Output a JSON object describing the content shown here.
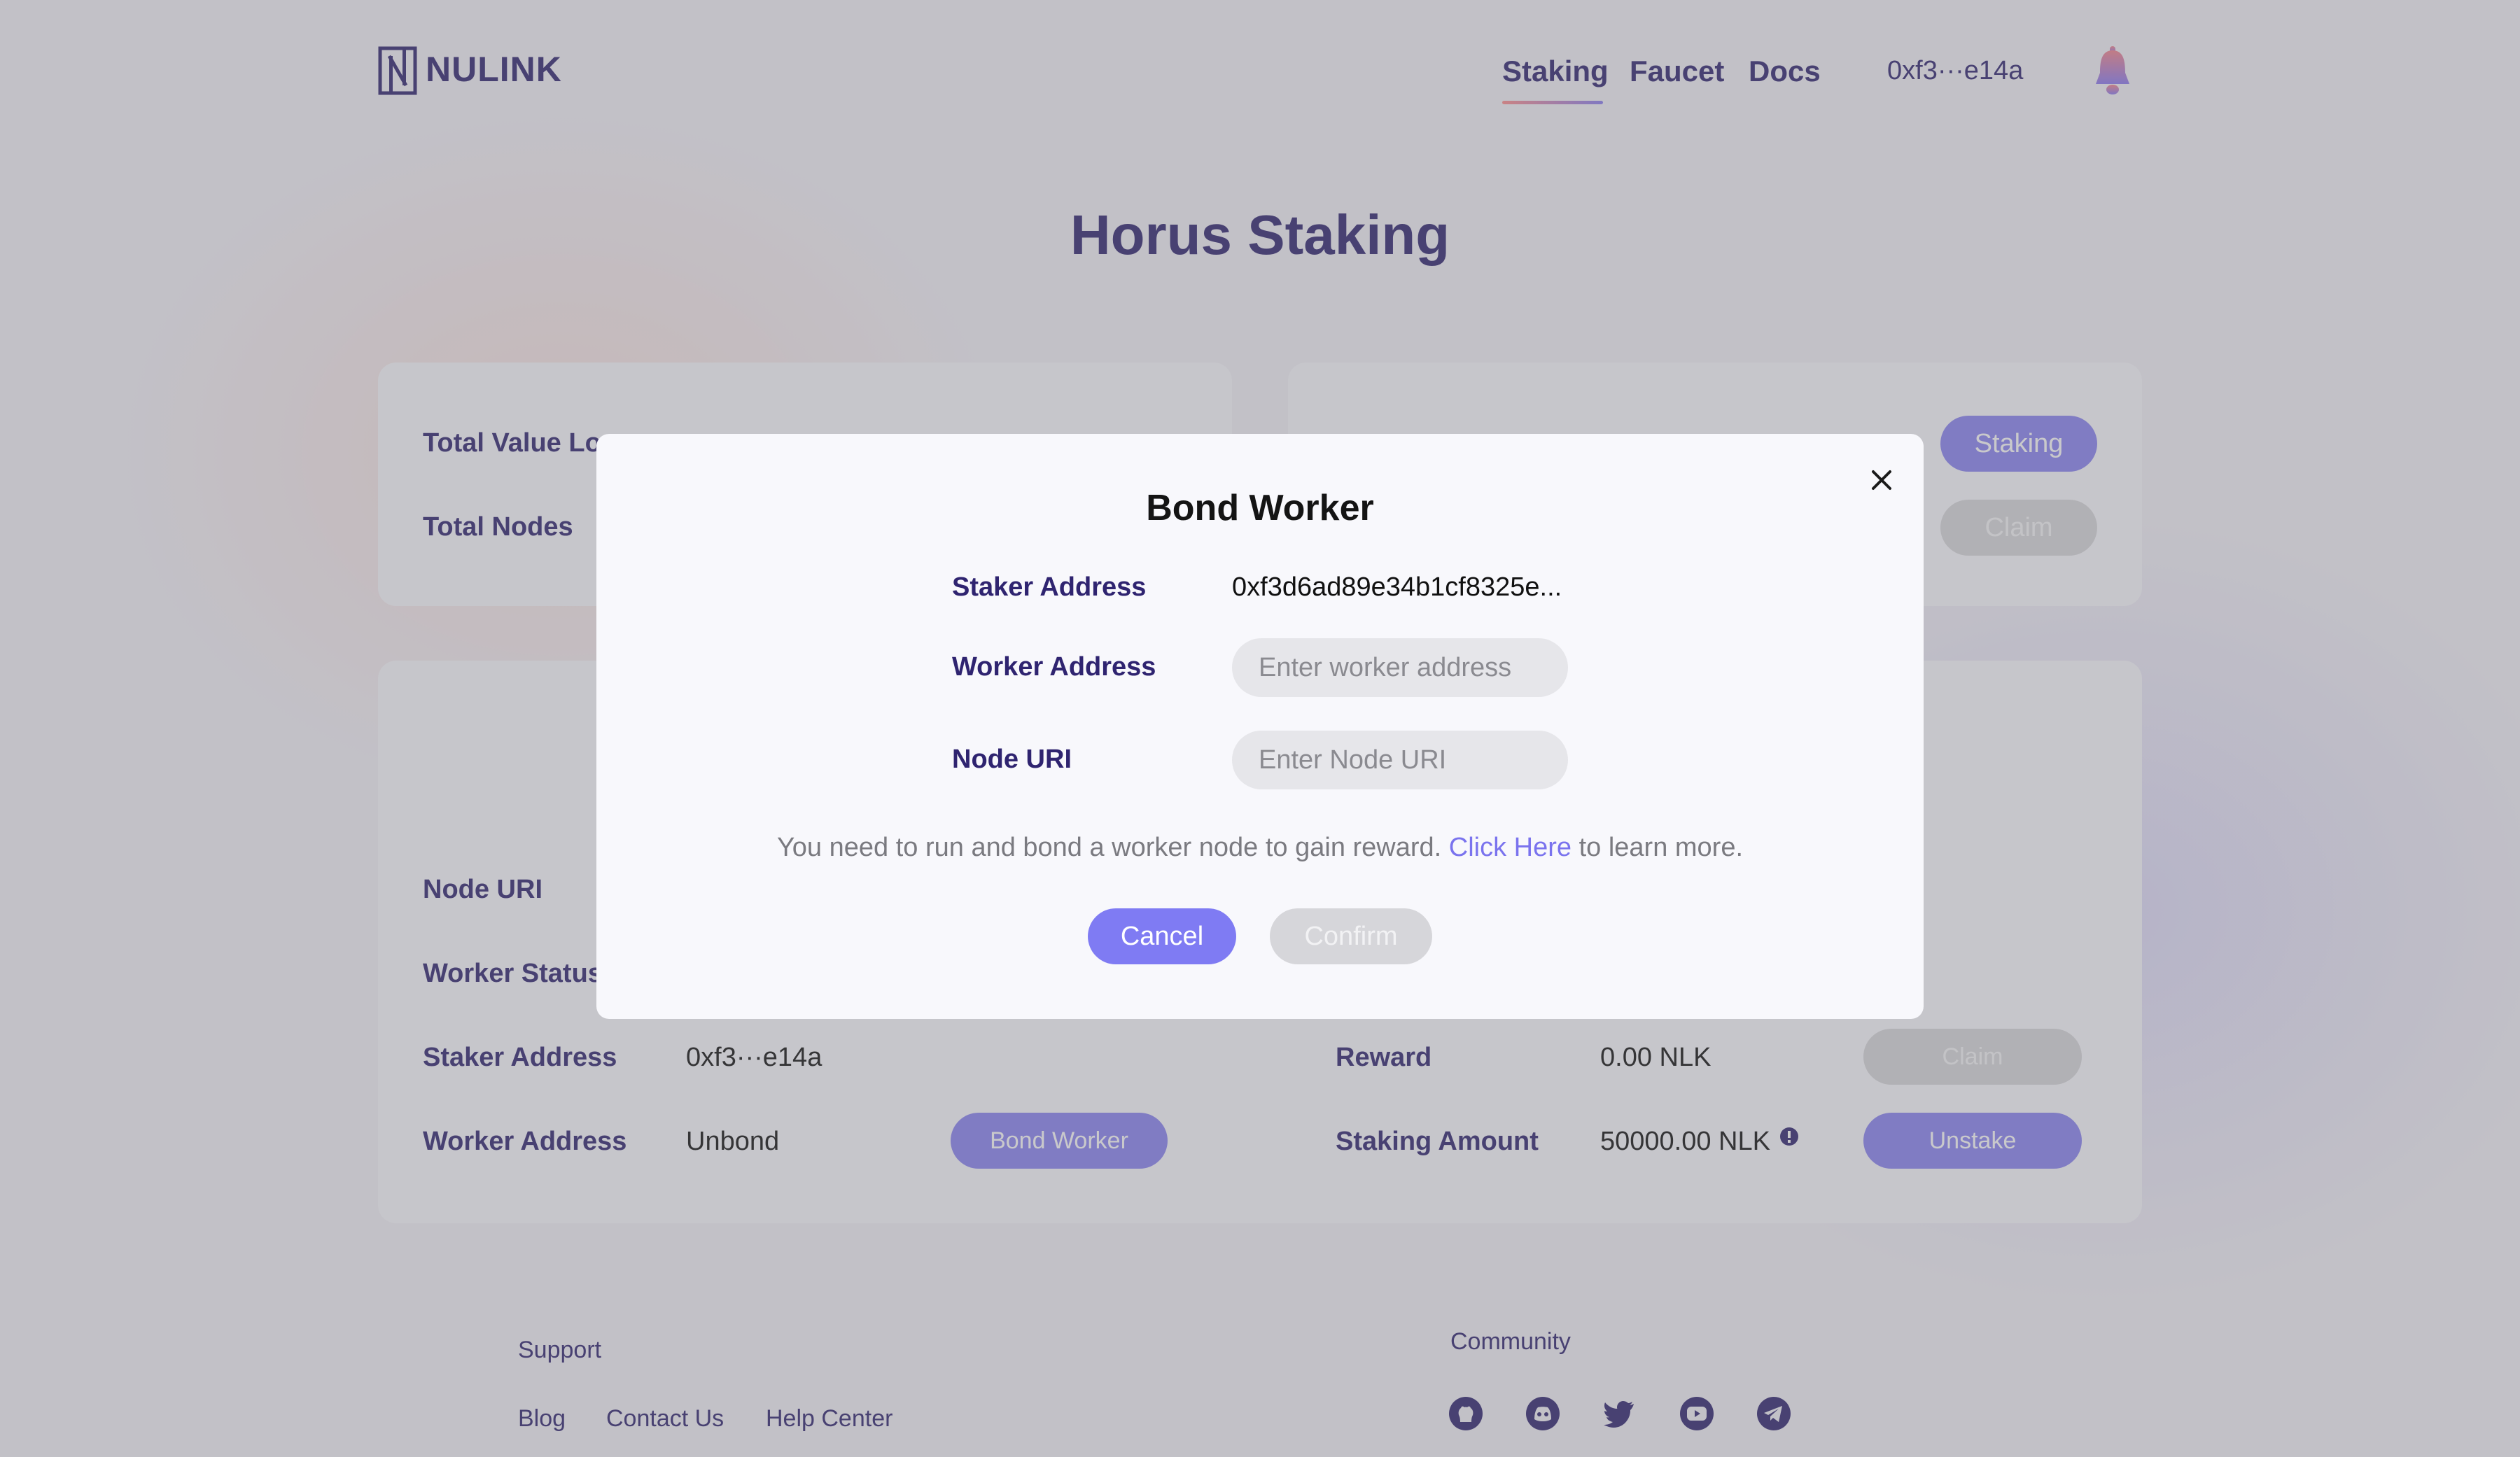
{
  "header": {
    "logo_text": "NULINK",
    "nav": [
      "Staking",
      "Faucet",
      "Docs"
    ],
    "wallet": "0xf3···e14a"
  },
  "page_title": "Horus Staking",
  "overview_card": {
    "total_value_locked_label": "Total Value Lo",
    "total_nodes_label": "Total Nodes"
  },
  "stake_card": {
    "staking_button": "Staking",
    "claim_button": "Claim"
  },
  "node_card": {
    "node_uri_label": "Node URI",
    "worker_status_label": "Worker Status",
    "staker_address_label": "Staker Address",
    "staker_address_value": "0xf3···e14a",
    "worker_address_label": "Worker Address",
    "worker_address_value": "Unbond",
    "bond_worker_button": "Bond Worker",
    "reward_label": "Reward",
    "reward_value": "0.00 NLK",
    "claim_button": "Claim",
    "staking_amount_label": "Staking Amount",
    "staking_amount_value": "50000.00 NLK",
    "unstake_button": "Unstake"
  },
  "footer": {
    "support_heading": "Support",
    "support_links": [
      "Blog",
      "Contact Us",
      "Help Center"
    ],
    "community_heading": "Community",
    "community_icons": [
      "github-icon",
      "discord-icon",
      "twitter-icon",
      "youtube-icon",
      "telegram-icon"
    ]
  },
  "modal": {
    "title": "Bond Worker",
    "staker_address_label": "Staker Address",
    "staker_address_value": "0xf3d6ad89e34b1cf8325e...",
    "worker_address_label": "Worker Address",
    "worker_address_placeholder": "Enter worker address",
    "node_uri_label": "Node URI",
    "node_uri_placeholder": "Enter Node URI",
    "note_before": "You need to run and bond a worker node to gain reward.",
    "note_link": "Click Here",
    "note_after": "to learn more.",
    "cancel": "Cancel",
    "confirm": "Confirm"
  },
  "colors": {
    "brand": "#2f2470",
    "accent": "#8a84f2",
    "disabled": "#d8d8dc"
  }
}
